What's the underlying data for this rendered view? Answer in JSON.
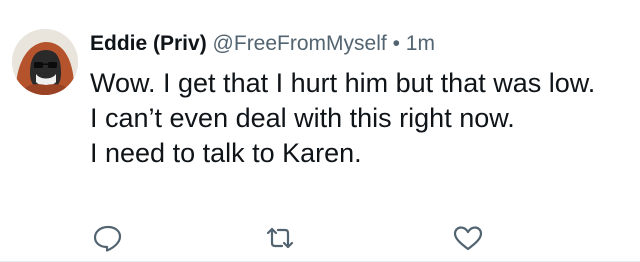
{
  "tweet": {
    "display_name": "Eddie (Priv)",
    "handle": "@FreeFromMyself",
    "separator": "•",
    "time": "1m",
    "lines": [
      "Wow. I get that I hurt him but that was low.",
      "I can’t even deal with this right now.",
      "I need to talk to Karen."
    ]
  },
  "actions": {
    "reply_icon": "reply-icon",
    "retweet_icon": "retweet-icon",
    "like_icon": "like-icon"
  },
  "colors": {
    "text": "#0f1419",
    "muted": "#536471",
    "icon": "#536471"
  }
}
